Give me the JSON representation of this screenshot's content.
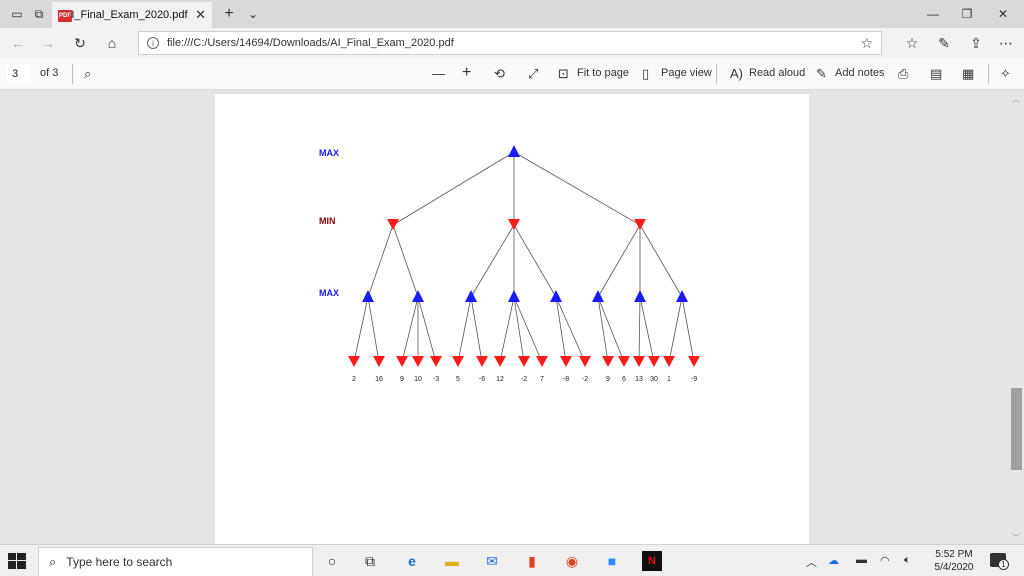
{
  "tab": {
    "title": "AI_Final_Exam_2020.pdf",
    "close": "✕",
    "new_tab": "+",
    "dropdown": "⌄"
  },
  "address": {
    "url": "file:///C:/Users/14694/Downloads/AI_Final_Exam_2020.pdf"
  },
  "pdf_toolbar": {
    "page_number": "3",
    "page_total": "of 3",
    "fit_to_page": "Fit to page",
    "page_view": "Page view",
    "read_aloud": "Read aloud",
    "add_notes": "Add notes"
  },
  "tree": {
    "level_labels": [
      "MAX",
      "MIN",
      "MAX"
    ],
    "leaf_values": [
      "2",
      "16",
      "9",
      "10",
      "-3",
      "5",
      "-6",
      "12",
      "-2",
      "7",
      "-8",
      "-2",
      "9",
      "6",
      "13",
      "30",
      "1",
      "-9"
    ],
    "colors": {
      "max_node": "#1a1aff",
      "min_node": "#ff1a1a",
      "max_label": "#1a1aff",
      "min_label": "#8b0000"
    }
  },
  "taskbar": {
    "search_placeholder": "Type here to search",
    "time": "5:52 PM",
    "date": "5/4/2020",
    "notification_count": "1"
  }
}
